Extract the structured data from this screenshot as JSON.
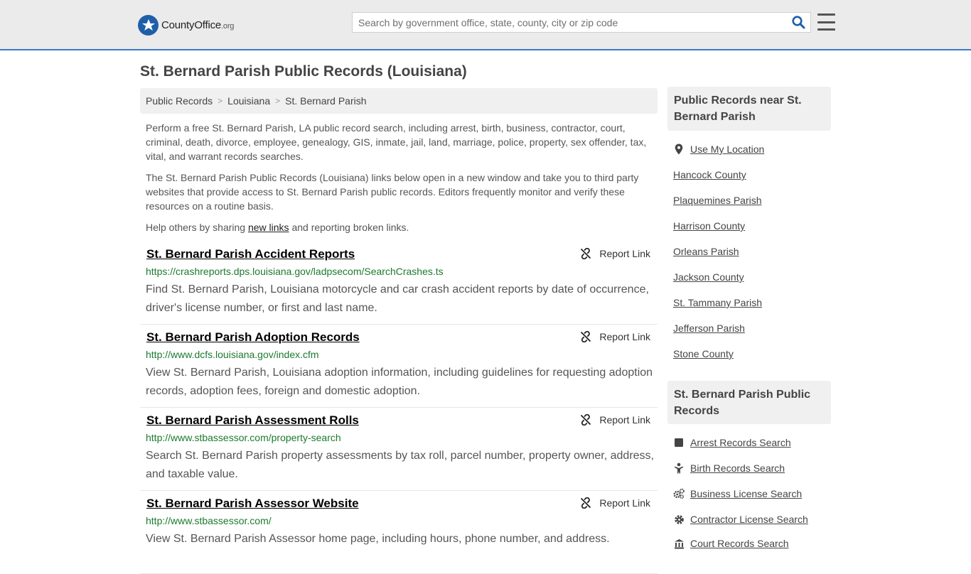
{
  "header": {
    "logo_main": "CountyOffice",
    "logo_suffix": ".org",
    "search_placeholder": "Search by government office, state, county, city or zip code"
  },
  "page": {
    "title": "St. Bernard Parish Public Records (Louisiana)"
  },
  "breadcrumb": [
    "Public Records",
    "Louisiana",
    "St. Bernard Parish"
  ],
  "intro": {
    "p1": "Perform a free St. Bernard Parish, LA public record search, including arrest, birth, business, contractor, court, criminal, death, divorce, employee, genealogy, GIS, inmate, jail, land, marriage, police, property, sex offender, tax, vital, and warrant records searches.",
    "p2": "The St. Bernard Parish Public Records (Louisiana) links below open in a new window and take you to third party websites that provide access to St. Bernard Parish public records. Editors frequently monitor and verify these resources on a routine basis.",
    "p3_before": "Help others by sharing ",
    "p3_link": "new links",
    "p3_after": " and reporting broken links."
  },
  "report_label": "Report Link",
  "records": [
    {
      "title": "St. Bernard Parish Accident Reports",
      "url": "https://crashreports.dps.louisiana.gov/ladpsecom/SearchCrashes.ts",
      "desc": "Find St. Bernard Parish, Louisiana motorcycle and car crash accident reports by date of occurrence, driver's license number, or first and last name."
    },
    {
      "title": "St. Bernard Parish Adoption Records",
      "url": "http://www.dcfs.louisiana.gov/index.cfm",
      "desc": "View St. Bernard Parish, Louisiana adoption information, including guidelines for requesting adoption records, adoption fees, foreign and domestic adoption."
    },
    {
      "title": "St. Bernard Parish Assessment Rolls",
      "url": "http://www.stbassessor.com/property-search",
      "desc": "Search St. Bernard Parish property assessments by tax roll, parcel number, property owner, address, and taxable value."
    },
    {
      "title": "St. Bernard Parish Assessor Website",
      "url": "http://www.stbassessor.com/",
      "desc": "View St. Bernard Parish Assessor home page, including hours, phone number, and address."
    }
  ],
  "sidebar": {
    "near_title": "Public Records near St. Bernard Parish",
    "use_location": "Use My Location",
    "near_items": [
      "Hancock County",
      "Plaquemines Parish",
      "Harrison County",
      "Orleans Parish",
      "Jackson County",
      "St. Tammany Parish",
      "Jefferson Parish",
      "Stone County"
    ],
    "records_title": "St. Bernard Parish Public Records",
    "record_items": [
      {
        "label": "Arrest Records Search",
        "icon": "square-icon"
      },
      {
        "label": "Birth Records Search",
        "icon": "baby-icon"
      },
      {
        "label": "Business License Search",
        "icon": "gears-icon"
      },
      {
        "label": "Contractor License Search",
        "icon": "gear-icon"
      },
      {
        "label": "Court Records Search",
        "icon": "courthouse-icon"
      }
    ]
  },
  "colors": {
    "accent": "#3a7bc8",
    "link_url_green": "#1c7a2e",
    "search_icon": "#1f5fa8"
  }
}
